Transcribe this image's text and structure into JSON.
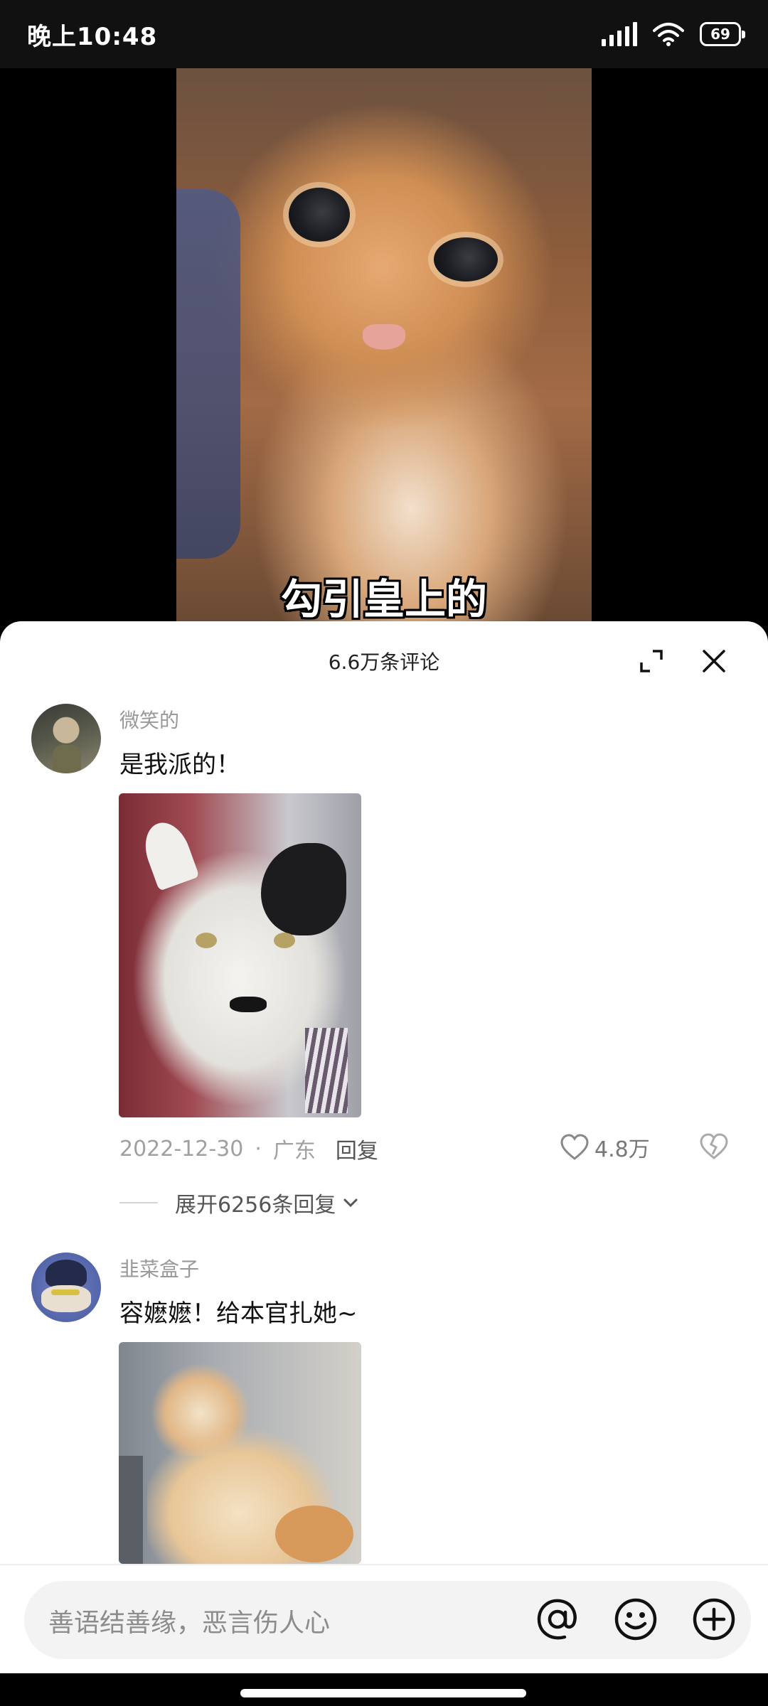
{
  "status_bar": {
    "time": "晚上10:48",
    "battery": "69"
  },
  "video": {
    "subtitle": "勾引皇上的"
  },
  "sheet": {
    "title": "6.6万条评论"
  },
  "comments": [
    {
      "username": "微笑的",
      "text": "是我派的！",
      "date": "2022-12-30",
      "location": "广东",
      "reply_label": "回复",
      "likes": "4.8万",
      "expand_label": "展开6256条回复"
    },
    {
      "username": "韭菜盒子",
      "text": "容嬷嬷！给本官扎她~"
    }
  ],
  "input": {
    "placeholder": "善语结善缘，恶言伤人心"
  },
  "icons": {
    "expand": "expand-icon",
    "close": "close-icon",
    "like": "heart-icon",
    "dislike": "broken-heart-icon",
    "mention": "at-icon",
    "emoji": "emoji-icon",
    "add": "plus-icon"
  }
}
